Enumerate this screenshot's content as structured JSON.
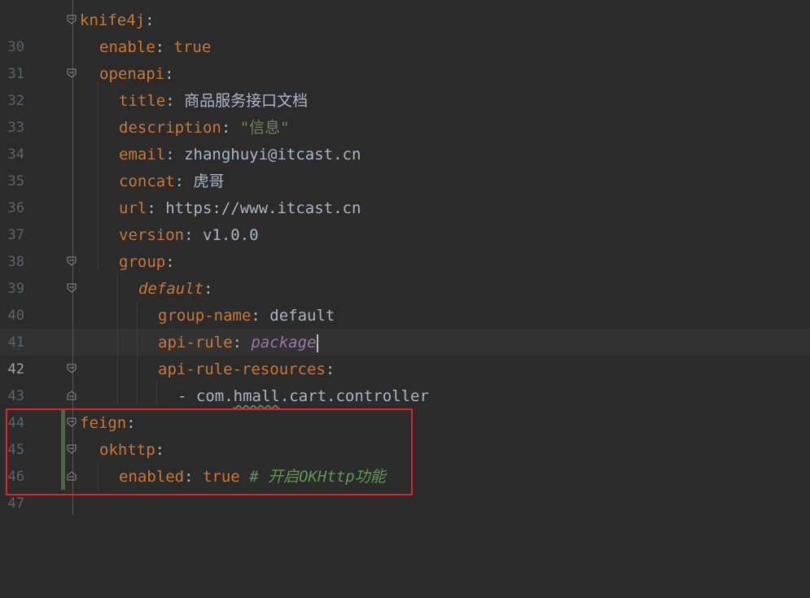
{
  "editor": {
    "current_line": "42",
    "lines": [
      {
        "num": "30",
        "key": "knife4j",
        "sep": ":",
        "value": ""
      },
      {
        "num": "31",
        "key": "enable",
        "sep": ": ",
        "value": "true"
      },
      {
        "num": "32",
        "key": "openapi",
        "sep": ":",
        "value": ""
      },
      {
        "num": "33",
        "key": "title",
        "sep": ": ",
        "value": "商品服务接口文档"
      },
      {
        "num": "34",
        "key": "description",
        "sep": ": ",
        "value": "\"信息\""
      },
      {
        "num": "35",
        "key": "email",
        "sep": ": ",
        "value": "zhanghuyi@itcast.cn"
      },
      {
        "num": "36",
        "key": "concat",
        "sep": ": ",
        "value": "虎哥"
      },
      {
        "num": "37",
        "key": "url",
        "sep": ": ",
        "value": "https://www.itcast.cn"
      },
      {
        "num": "38",
        "key": "version",
        "sep": ": ",
        "value": "v1.0.0"
      },
      {
        "num": "39",
        "key": "group",
        "sep": ":",
        "value": ""
      },
      {
        "num": "40",
        "key": "default",
        "sep": ":",
        "value": ""
      },
      {
        "num": "41",
        "key": "group-name",
        "sep": ": ",
        "value": "default"
      },
      {
        "num": "42",
        "key": "api-rule",
        "sep": ": ",
        "value": "package"
      },
      {
        "num": "43",
        "key": "api-rule-resources",
        "sep": ":",
        "value": ""
      },
      {
        "num": "44",
        "dash": "- ",
        "value_a": "com.",
        "value_b": "hmall",
        "value_c": ".cart.controller"
      },
      {
        "num": "45",
        "key": "feign",
        "sep": ":",
        "value": ""
      },
      {
        "num": "46",
        "key": "okhttp",
        "sep": ":",
        "value": ""
      },
      {
        "num": "47",
        "key": "enabled",
        "sep": ": ",
        "value": "true",
        "comment": "# 开启OKHttp功能"
      }
    ]
  }
}
